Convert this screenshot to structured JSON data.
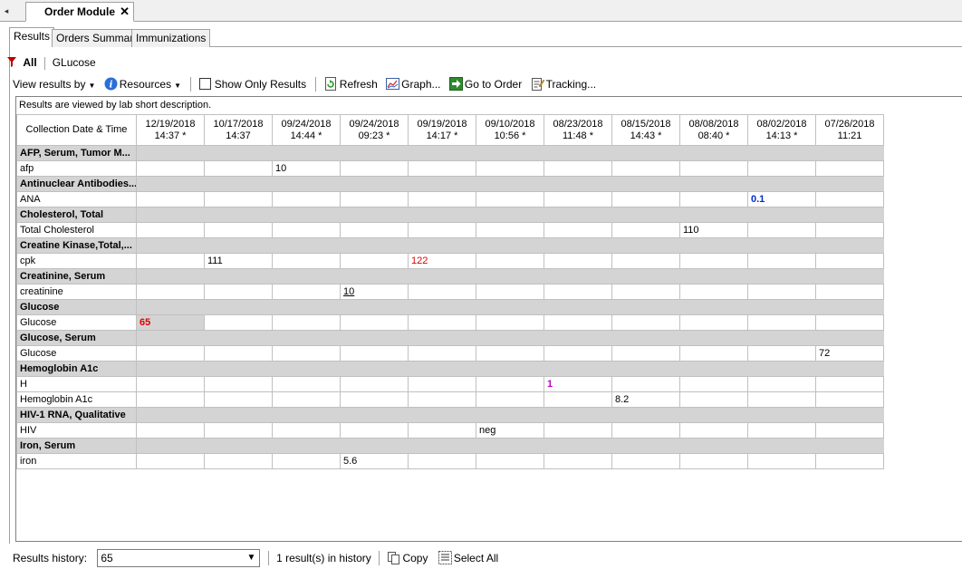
{
  "document_tab": {
    "nav_glyph": "◂",
    "title": "Order Module",
    "close_glyph": "✕"
  },
  "tabs": [
    {
      "label": "Results",
      "active": true
    },
    {
      "label": "Orders Summary",
      "active": false
    },
    {
      "label": "Immunizations",
      "active": false
    }
  ],
  "filter_bar": {
    "icon": "filter-icon",
    "all_label": "All",
    "filter_text": "GLucose"
  },
  "toolbar": {
    "view_results_by": "View results by",
    "resources": "Resources",
    "show_only_results": "Show Only Results",
    "refresh": "Refresh",
    "graph": "Graph...",
    "go_to_order": "Go to Order",
    "tracking": "Tracking..."
  },
  "grid": {
    "note": "Results are viewed by lab short description.",
    "row_header_label": "Collection Date & Time",
    "columns": [
      {
        "date": "12/19/2018",
        "time": "14:37 *"
      },
      {
        "date": "10/17/2018",
        "time": "14:37"
      },
      {
        "date": "09/24/2018",
        "time": "14:44 *"
      },
      {
        "date": "09/24/2018",
        "time": "09:23 *"
      },
      {
        "date": "09/19/2018",
        "time": "14:17 *"
      },
      {
        "date": "09/10/2018",
        "time": "10:56 *"
      },
      {
        "date": "08/23/2018",
        "time": "11:48 *"
      },
      {
        "date": "08/15/2018",
        "time": "14:43 *"
      },
      {
        "date": "08/08/2018",
        "time": "08:40 *"
      },
      {
        "date": "08/02/2018",
        "time": "14:13 *"
      },
      {
        "date": "07/26/2018",
        "time": "11:21"
      }
    ],
    "rows": [
      {
        "type": "group",
        "label": "AFP, Serum, Tumor M..."
      },
      {
        "type": "data",
        "label": "afp",
        "cells": {
          "2": {
            "v": "10"
          }
        }
      },
      {
        "type": "group",
        "label": "Antinuclear Antibodies..."
      },
      {
        "type": "data",
        "label": "ANA",
        "cells": {
          "9": {
            "v": "0.1",
            "style": "blue-bold"
          }
        }
      },
      {
        "type": "group",
        "label": "Cholesterol, Total"
      },
      {
        "type": "data",
        "label": "Total Cholesterol",
        "cells": {
          "8": {
            "v": "110"
          }
        }
      },
      {
        "type": "group",
        "label": "Creatine Kinase,Total,..."
      },
      {
        "type": "data",
        "label": "cpk",
        "cells": {
          "1": {
            "v": "111"
          },
          "4": {
            "v": "122",
            "style": "red"
          }
        }
      },
      {
        "type": "group",
        "label": "Creatinine, Serum"
      },
      {
        "type": "data",
        "label": "creatinine",
        "cells": {
          "3": {
            "v": "10",
            "style": "under"
          }
        }
      },
      {
        "type": "group",
        "label": "Glucose"
      },
      {
        "type": "data",
        "label": "Glucose",
        "cells": {
          "0": {
            "v": "65",
            "style": "red-bold",
            "selected": true
          }
        }
      },
      {
        "type": "group",
        "label": "Glucose, Serum"
      },
      {
        "type": "data",
        "label": "Glucose",
        "cells": {
          "10": {
            "v": "72"
          }
        }
      },
      {
        "type": "group",
        "label": "Hemoglobin A1c"
      },
      {
        "type": "data",
        "label": "H",
        "cells": {
          "6": {
            "v": "1",
            "style": "magenta-bold"
          }
        }
      },
      {
        "type": "data",
        "label": "Hemoglobin A1c",
        "cells": {
          "7": {
            "v": "8.2"
          }
        }
      },
      {
        "type": "group",
        "label": "HIV-1 RNA, Qualitative"
      },
      {
        "type": "data",
        "label": "HIV",
        "cells": {
          "5": {
            "v": "neg"
          }
        }
      },
      {
        "type": "group",
        "label": "Iron, Serum"
      },
      {
        "type": "data",
        "label": "iron",
        "cells": {
          "3": {
            "v": "5.6"
          }
        }
      }
    ]
  },
  "status_bar": {
    "results_history_label": "Results history:",
    "results_history_value": "65",
    "history_count": "1 result(s) in history",
    "copy": "Copy",
    "select_all": "Select All"
  },
  "colors": {
    "abnormal_red": "#e00000",
    "blue_value": "#0030c0",
    "magenta_value": "#c000c0",
    "group_row": "#d4d4d4"
  }
}
